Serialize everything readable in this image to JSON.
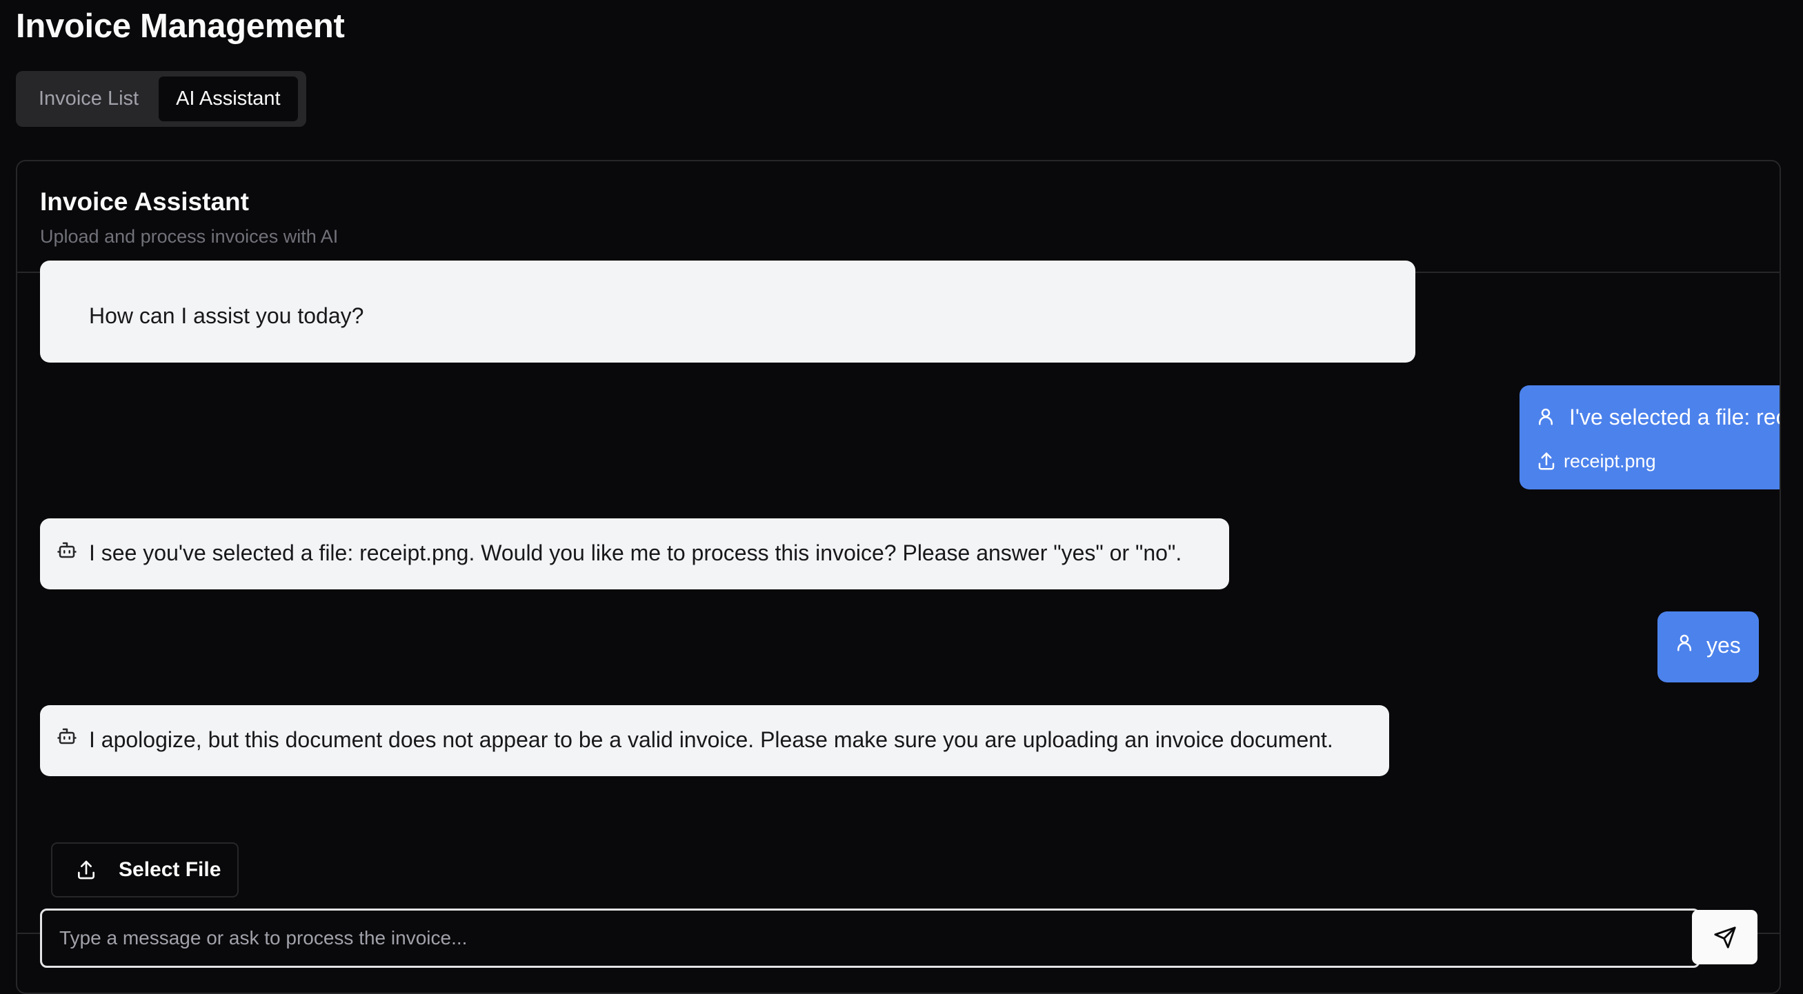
{
  "page": {
    "title": "Invoice Management"
  },
  "tabs": [
    {
      "label": "Invoice List",
      "active": false
    },
    {
      "label": "AI Assistant",
      "active": true
    }
  ],
  "assistant": {
    "title": "Invoice Assistant",
    "description": "Upload and process invoices with AI"
  },
  "messages": [
    {
      "role": "assistant",
      "text": "How can I assist you today?"
    },
    {
      "role": "user",
      "text": "I've selected a file: receipt.png",
      "attachment": "receipt.png"
    },
    {
      "role": "assistant",
      "text": "I see you've selected a file: receipt.png. Would you like me to process this invoice? Please answer \"yes\" or \"no\"."
    },
    {
      "role": "user",
      "text": "yes"
    },
    {
      "role": "assistant",
      "text": "I apologize, but this document does not appear to be a valid invoice. Please make sure you are uploading an invoice document."
    }
  ],
  "composer": {
    "select_file_label": "Select File",
    "input_placeholder": "Type a message or ask to process the invoice...",
    "input_value": ""
  },
  "icons": {
    "user": "user-icon",
    "bot": "bot-icon",
    "upload": "upload-icon",
    "send": "send-icon"
  },
  "colors": {
    "background": "#09090b",
    "user_bubble": "#4c82ec",
    "bot_bubble": "#f3f4f6",
    "border": "#27272a"
  }
}
